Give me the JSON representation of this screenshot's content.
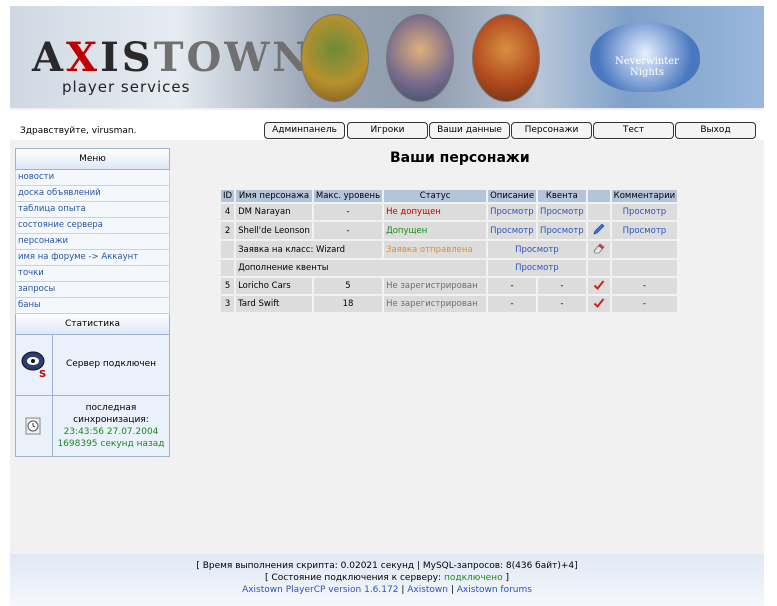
{
  "banner": {
    "logo_a": "A",
    "logo_x": "X",
    "logo_is": "IS",
    "logo_town": "TOWN",
    "logo_sub": "player services",
    "nwn_text": "Neverwinter Nights"
  },
  "toolbar": {
    "greeting": "Здравствуйте, virusman.",
    "buttons": [
      "Админпанель",
      "Игроки",
      "Ваши данные",
      "Персонажи",
      "Тест",
      "Выход"
    ]
  },
  "sidebar": {
    "menu_title": "Меню",
    "items": [
      "новости",
      "доска объявлений",
      "таблица опыта",
      "состояние сервера",
      "персонажи",
      "имя на форуме -> Аккаунт",
      "точки",
      "запросы",
      "баны"
    ],
    "stats_title": "Статистика",
    "server_status": "Сервер подключен",
    "sync_label": "последная синхронизация:",
    "sync_time": "23:43:56 27.07.2004",
    "sync_ago": "1698395 секунд назад"
  },
  "main": {
    "title": "Ваши персонажи",
    "headers": [
      "ID",
      "Имя персонажа",
      "Макс. уровень",
      "Статус",
      "Описание",
      "Квента",
      "",
      "Комментарии"
    ],
    "rows": [
      {
        "id": "4",
        "name": "DM Narayan",
        "level": "-",
        "status": "Не допущен",
        "desc": "Просмотр",
        "quenta": "Просмотр",
        "comment": "Просмотр"
      },
      {
        "id": "2",
        "name": "Shell'de Leonson",
        "level": "-",
        "status": "Допущен",
        "desc": "Просмотр",
        "quenta": "Просмотр",
        "comment": "Просмотр"
      }
    ],
    "class_request": {
      "label": "Заявка на класс: Wizard",
      "status": "Заявка отправлена",
      "link": "Просмотр"
    },
    "quenta_addition": {
      "label": "Дополнение квенты",
      "link": "Просмотр"
    },
    "rows2": [
      {
        "id": "5",
        "name": "Loricho Cars",
        "level": "5",
        "status": "Не зарегистрирован",
        "desc": "-",
        "quenta": "-",
        "comment": "-"
      },
      {
        "id": "3",
        "name": "Tard Swift",
        "level": "18",
        "status": "Не зарегистрирован",
        "desc": "-",
        "quenta": "-",
        "comment": "-"
      }
    ]
  },
  "footer": {
    "line1": "[ Время выполнения скрипта: 0.02021 секунд | MySQL-запросов: 8(436 байт)+4]",
    "line2_pre": "[ Состояние подключения к серверу: ",
    "line2_status": "подключено",
    "line2_post": " ]",
    "link_version": "Axistown PlayerCP version 1.6.172",
    "sep": " | ",
    "link_site": "Axistown",
    "link_forums": "Axistown forums"
  }
}
